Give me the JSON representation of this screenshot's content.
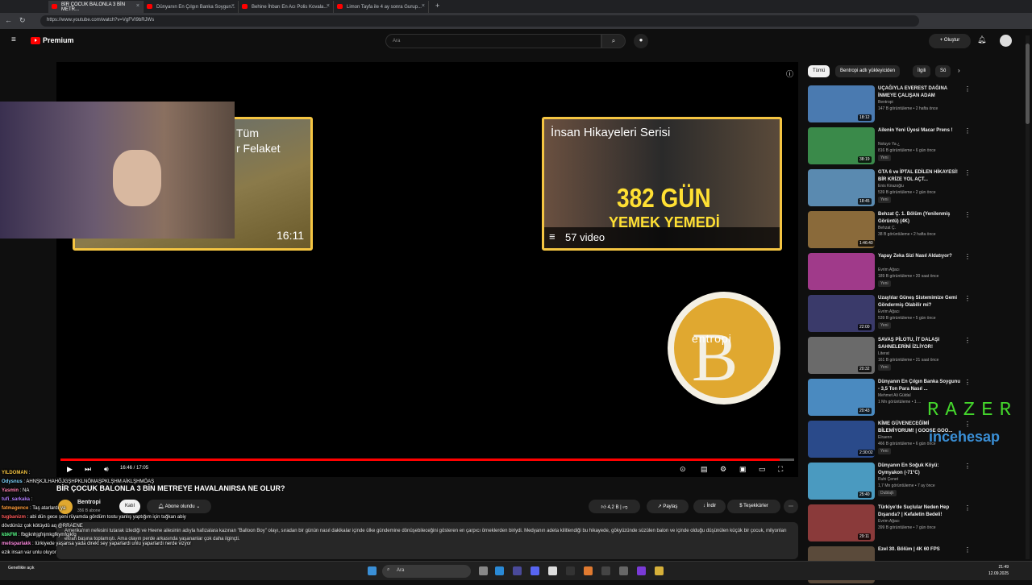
{
  "browser": {
    "tabs": [
      {
        "label": "BİR ÇOCUK BALONLA 3 BİN METR..."
      },
      {
        "label": "Dünyanın En Çılgın Banka Soygun..."
      },
      {
        "label": "Behine İhbarı En Acı Polis Kovala..."
      },
      {
        "label": "Limon Tayfa ile 4 ay sonra Gurup..."
      }
    ],
    "url": "https://www.youtube.com/watch?v=VgFVI9bRJWs"
  },
  "header": {
    "brand": "Premium",
    "search_placeholder": "Ara",
    "create_label": "Oluştur"
  },
  "player": {
    "card1_title": "Tüm\nr Felaket",
    "card1_duration": "16:11",
    "card2_title": "İnsan Hikayeleri Serisi",
    "card2_big": "382 GÜN",
    "card2_big2": "YEMEK YEMEDİ",
    "card2_playlist": "57 video",
    "badge_label": "entropi",
    "time_readout": "16:46 / 17:05",
    "progress_fraction": 0.98
  },
  "video": {
    "title": "BİR ÇOCUK BALONLA 3 BİN METREYE HAVALANIRSA NE OLUR?",
    "channel_name": "Bentropi",
    "subscribers": "356 B abone",
    "join_label": "Katıl",
    "subscribed_label": "Abone olundu",
    "likes": "4,2 B",
    "share_label": "Paylaş",
    "download_label": "İndir",
    "thanks_label": "Teşekkürler",
    "description": "Amerika'nın nefesini tutarak izlediği ve Heene ailesinin adıyla hafızalara kazınan \"Balloon Boy\" olayı, sıradan bir günün nasıl dakikalar içinde ülke gündemine dönüşebileceğini gösteren en çarpıcı örneklerden biriydi. Medyanın adeta kilitlendiği bu hikayede, gökyüzünde süzülen balon ve içinde olduğu düşünülen küçük bir çocuk, milyonları ekran başına toplamıştı. Ama olayın perde arkasında yaşananlar çok daha ilginçti."
  },
  "chat": [
    {
      "user": "YILDOMAN",
      "msg": "",
      "color": "#f5c542"
    },
    {
      "user": "Odysnus",
      "msg": "AHNŞKJLHAHĞJGŞHPKLNÖMAŞPKLŞHM AİKLŞHMÖAŞ",
      "color": "#7fd6ff"
    },
    {
      "user": "Yasmin",
      "msg": "NA",
      "color": "#ff7fae"
    },
    {
      "user": "tufi_sarkaka",
      "msg": "",
      "color": "#b27fff"
    },
    {
      "user": "fatmagence",
      "msg": "Taş atarlardı ya",
      "color": "#ff9c3a"
    },
    {
      "user": "tugbanizm",
      "msg": "abi dün gece şeni rüyamda gördüm tostu yanlış yaptığım için tuğkan abiy",
      "color": "#ff5a5a"
    },
    {
      "user": "",
      "msg": "dövdünüz çok kötüydü aq @RRAENE",
      "color": "#ffffff"
    },
    {
      "user": "kbkFM",
      "msg": "fbgjknhjgfnjmkgfkymfgjkfg",
      "color": "#5aff8a"
    },
    {
      "user": "melisparlakk",
      "msg": "türkiyede yaşansa yada direkt sey yaparlardi unlu yaparlardi nerde vizyor",
      "color": "#ff8ae0"
    },
    {
      "user": "",
      "msg": "ezik insan var unlu oluyor",
      "color": "#ffffff"
    }
  ],
  "chips": [
    "Tümü",
    "Bentropi adlı yükleyiciden",
    "İlgili",
    "Sö"
  ],
  "recommendations": [
    {
      "title": "UÇAĞIYLA EVEREST DAĞINA İNMEYE ÇALIŞAN ADAM",
      "channel": "Bentropi",
      "meta": "147 B görüntüleme • 2 hafta önce",
      "duration": "18:12",
      "new": "",
      "color": "#4a7ab0"
    },
    {
      "title": "Ailenin Yeni Üyesi Macar Prens !",
      "channel": "Noluyo Ya ¿",
      "meta": "816 B görüntüleme • 6 gün önce",
      "duration": "38:19",
      "new": "Yeni",
      "color": "#3a8a4a"
    },
    {
      "title": "GTA 6 ve İPTAL EDİLEN HİKAYESİ! BİR KRİZE YOL AÇT...",
      "channel": "Enis Kirazoğlu",
      "meta": "539 B görüntüleme • 2 gün önce",
      "duration": "18:45",
      "new": "Yeni",
      "color": "#5a8ab0"
    },
    {
      "title": "Behzat Ç. 1. Bölüm (Yenilenmiş Görüntü) (4K)",
      "channel": "Behzat Ç.",
      "meta": "38 B görüntüleme • 2 hafta önce",
      "duration": "1:46:40",
      "new": "",
      "color": "#8a6a3a"
    },
    {
      "title": "Yapay Zeka Sizi Nasıl Aldatıyor?",
      "channel": "Evrim Ağacı",
      "meta": "189 B görüntüleme • 20 saat önce",
      "duration": "",
      "new": "Yeni",
      "color": "#a03a8a"
    },
    {
      "title": "Uzaylılar Güneş Sistemimize Gemi Göndermiş Olabilir mi?",
      "channel": "Evrim Ağacı",
      "meta": "539 B görüntüleme • 5 gün önce",
      "duration": "22:00",
      "new": "Yeni",
      "color": "#3a3a6a"
    },
    {
      "title": "SAVAŞ PİLOTU, İT DALAŞI SAHNELERİNİ İZLİYOR!",
      "channel": "Literat",
      "meta": "161 B görüntüleme • 21 saat önce",
      "duration": "20:32",
      "new": "Yeni",
      "color": "#6a6a6a"
    },
    {
      "title": "Dünyanın En Çılgın Banka Soygunu - 3,5 Ton Para Nasıl ...",
      "channel": "Mehmet Ali Güldal",
      "meta": "1 Mn görüntüleme • 1 ...",
      "duration": "20:43",
      "new": "",
      "color": "#4a8ac0"
    },
    {
      "title": "KİME GÜVENECEĞİMİ BİLEMİYORUM! | GOOSE GOO...",
      "channel": "Elraenn",
      "meta": "466 B görüntüleme • 6 gün önce",
      "duration": "2:30:02",
      "new": "Yeni",
      "color": "#2a4a8a"
    },
    {
      "title": "Dünyanın En Soğuk Köyü: Oymyakon (-71°C)",
      "channel": "Ruhi Çenet",
      "meta": "1,7 Mn görüntüleme • 7 ay önce",
      "duration": "25:40",
      "new": "Dublajlı",
      "color": "#4a9ac0"
    },
    {
      "title": "Türkiye'de Suçlular Neden Hep Dışarıda? | Kefaletin Bedeli!",
      "channel": "Evrim Ağacı",
      "meta": "399 B görüntüleme • 7 gün önce",
      "duration": "29:11",
      "new": "",
      "color": "#8a3a3a"
    },
    {
      "title": "Ezel 30. Bölüm | 4K 60 FPS",
      "channel": "",
      "meta": "",
      "duration": "",
      "new": "",
      "color": "#5a4a3a"
    }
  ],
  "overlay": {
    "razer": "RAZER",
    "ince": "incehesap"
  },
  "taskbar": {
    "search": "Ara",
    "weather_line": "Genellikle açık",
    "time": "21:49",
    "date": "12.09.2025"
  }
}
